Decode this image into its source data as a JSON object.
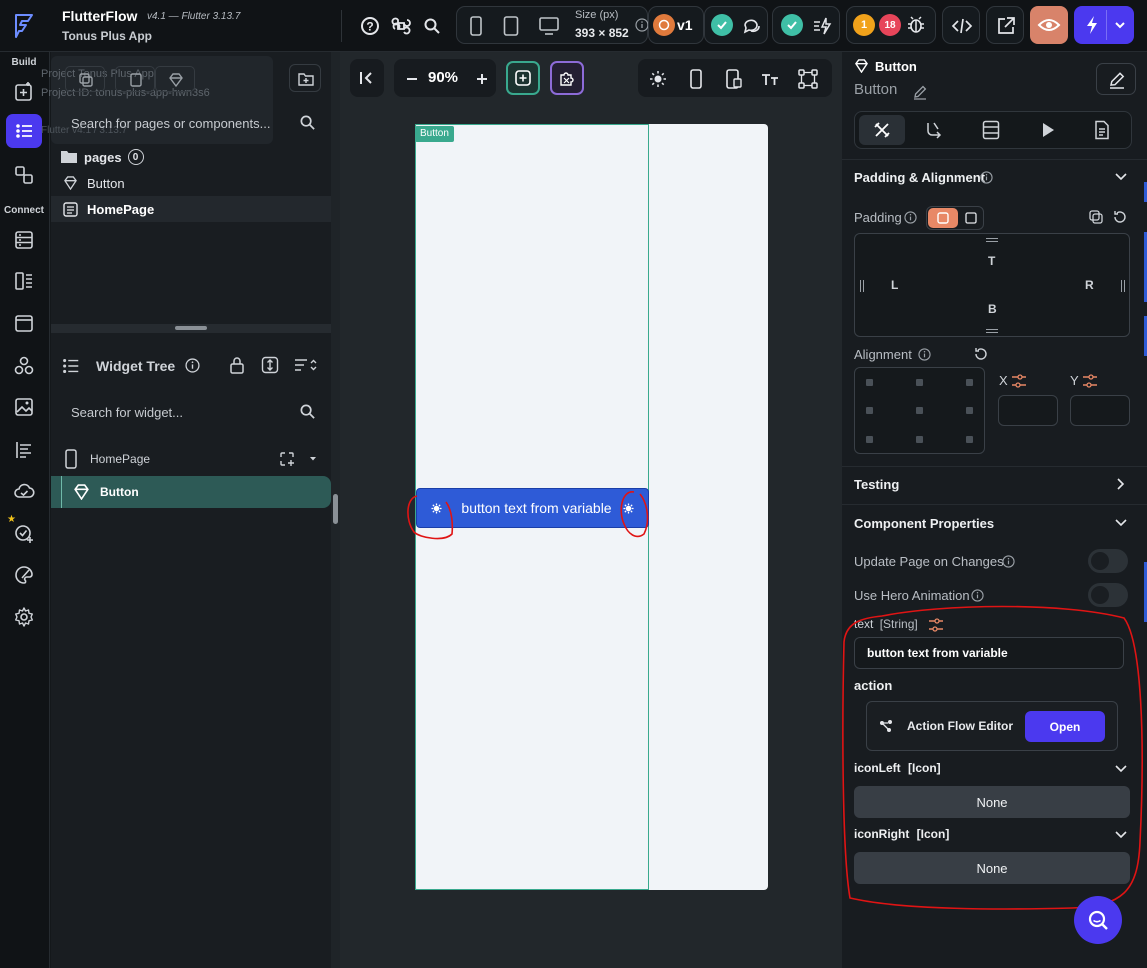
{
  "app": {
    "name": "FlutterFlow",
    "version": "v4.1 — Flutter 3.13.7",
    "project": "Tonus Plus App"
  },
  "topbar": {
    "size_label": "Size (px)",
    "size_value": "393 × 852",
    "version_badge": "v1",
    "warning_count": "1",
    "error_count": "18"
  },
  "rail": {
    "build_label": "Build",
    "connect_label": "Connect"
  },
  "left_panel": {
    "ghost_project_1": "Project Tonus Plus App",
    "ghost_project_2": "Project ID: tonus-plus-app-hwn3s6",
    "ghost_flutter": "Flutter v4.1 / 3.13.7",
    "search_placeholder": "Search for pages or components...",
    "pages_label": "pages",
    "pages_count": "0",
    "items": [
      {
        "label": "Button"
      },
      {
        "label": "HomePage"
      }
    ],
    "widget_tree_title": "Widget Tree",
    "widget_search_placeholder": "Search for widget...",
    "tree": [
      {
        "label": "HomePage"
      },
      {
        "label": "Button"
      }
    ]
  },
  "canvas": {
    "zoom": "90%",
    "frame_label": "Button",
    "button_text": "button text from variable"
  },
  "right_panel": {
    "widget_type": "Button",
    "widget_name": "Button",
    "padding_alignment_title": "Padding & Alignment",
    "padding_label": "Padding",
    "pad_top": "T",
    "pad_left": "L",
    "pad_right": "R",
    "pad_bottom": "B",
    "alignment_label": "Alignment",
    "x_label": "X",
    "y_label": "Y",
    "testing_title": "Testing",
    "component_props_title": "Component Properties",
    "update_page_label": "Update Page on Changes",
    "hero_label": "Use Hero Animation",
    "text_label": "text",
    "text_type": "[String]",
    "text_value": "button text from variable",
    "action_label": "action",
    "action_flow_label": "Action Flow Editor",
    "open_button": "Open",
    "icon_left_label": "iconLeft",
    "icon_left_type": "[Icon]",
    "icon_left_value": "None",
    "icon_right_label": "iconRight",
    "icon_right_type": "[Icon]",
    "icon_right_value": "None"
  },
  "colors": {
    "accent": "#4b39ef",
    "teal": "#39a98e",
    "canvas_button": "#2e5bd7",
    "annotation": "#e01414"
  }
}
